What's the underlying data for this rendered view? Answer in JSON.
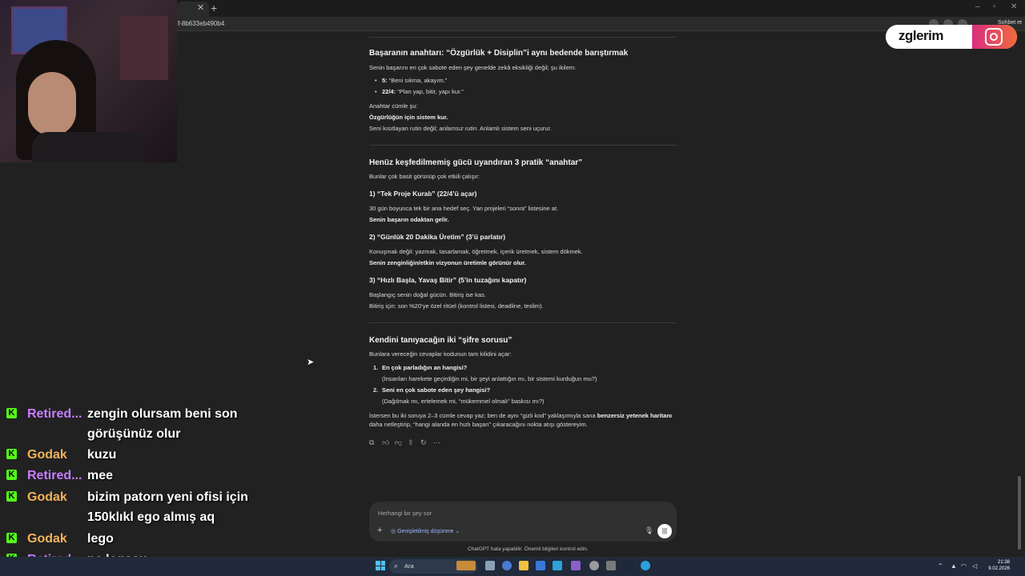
{
  "browser": {
    "url_fragment": "f-8b633eb490b4",
    "share_label": "Sohbet et"
  },
  "watermark": {
    "text": "zglerim"
  },
  "content": {
    "s1_title": "Başaranın anahtarı: “Özgürlük + Disiplin”i aynı bedende barıştırmak",
    "s1_intro": "Senin başarını en çok sabote eden şey genelde zekâ eksikliği değil; şu ikilem:",
    "s1_b1_key": "5:",
    "s1_b1_val": " “Beni sıkma, akayım.”",
    "s1_b2_key": "22/4:",
    "s1_b2_val": " “Plan yap, bitir, yapı kur.”",
    "s1_key_label": "Anahtar cümle şu:",
    "s1_key_bold": "Özgürlüğün için sistem kur.",
    "s1_key_tail_a": "Seni kısıtlayan rutin değil;",
    "s1_key_tail_i": " anlamsız rutin",
    "s1_key_tail_b": ". Anlamlı sistem seni uçurur.",
    "s2_title": "Henüz keşfedilmemiş gücü uyandıran 3 pratik “anahtar”",
    "s2_intro": "Bunlar çok basit görünüp çok etkili çalışır:",
    "k1_title": "1) “Tek Proje Kuralı” (22/4’ü açar)",
    "k1_line": "30 gün boyunca tek bir ana hedef seç. Yan projeleri “sonra” listesine at.",
    "k1_bold": "Senin başarın odaktan gelir.",
    "k2_title": "2) “Günlük 20 Dakika Üretim” (3’ü parlatır)",
    "k2_line": "Konuşmak değil: yazmak, tasarlamak, öğretmek, içerik üretmek, sistem dökmek.",
    "k2_bold": "Senin zenginliğin/etkin vizyonun üretimle görünür olur.",
    "k3_title": "3) “Hızlı Başla, Yavaş Bitir” (5’in tuzağını kapatır)",
    "k3_line1": "Başlangıç senin doğal gücün. Bitiriş ise kas.",
    "k3_line2": "Bitiriş için: son %20’ye özel ritüel (kontrol listesi, deadline, teslim).",
    "s3_title": "Kendini tanıyacağın iki “şifre sorusu”",
    "s3_intro": "Bunlara vereceğin cevaplar kodunun tam kilidini açar:",
    "q1_num": "1.",
    "q1_title": "En çok parladığın an hangisi?",
    "q1_line": "(İnsanları harekete geçirdiğin mi, bir şeyi anlattığın mı, bir sistemi kurduğun mu?)",
    "q2_num": "2.",
    "q2_title": "Seni en çok sabote eden şey hangisi?",
    "q2_line": "(Dağılmak mı, ertelemek mi, “mükemmel olmalı” baskısı mı?)",
    "outro_a": "İstersen bu iki soruya 2–3 cümle cevap yaz; ben de aynı “gizli kod” yaklaşımıyla sana ",
    "outro_b": "benzersiz yetenek haritanı",
    "outro_c": " daha netleştirip, “hangi alanda en hızlı başarı” çıkaracağını nokta atışı göstereyim."
  },
  "composer": {
    "placeholder": "Herhangi bir şey sor",
    "tool_label": "Genişletilmiş düşünme",
    "disclaimer": "ChatGPT hata yapabilir. Önemli bilgileri kontrol edin."
  },
  "chat": [
    {
      "user": "Retired...",
      "text": "zengin olursam beni son görüşünüz olur",
      "color": "#c77dff"
    },
    {
      "user": "Godak",
      "text": "kuzu",
      "color": "#f2b25a"
    },
    {
      "user": "Retired...",
      "text": "mee",
      "color": "#c77dff"
    },
    {
      "user": "Godak",
      "text": "bizim patorn yeni ofisi için 150klıkl ego almış aq",
      "color": "#f2b25a"
    },
    {
      "user": "Godak",
      "text": "lego",
      "color": "#f2b25a"
    },
    {
      "user": "Retired...",
      "text": "ne legosu",
      "color": "#c77dff"
    }
  ],
  "taskbar": {
    "search_label": "Ara",
    "time": "21:38",
    "date": "9.02.2026"
  }
}
